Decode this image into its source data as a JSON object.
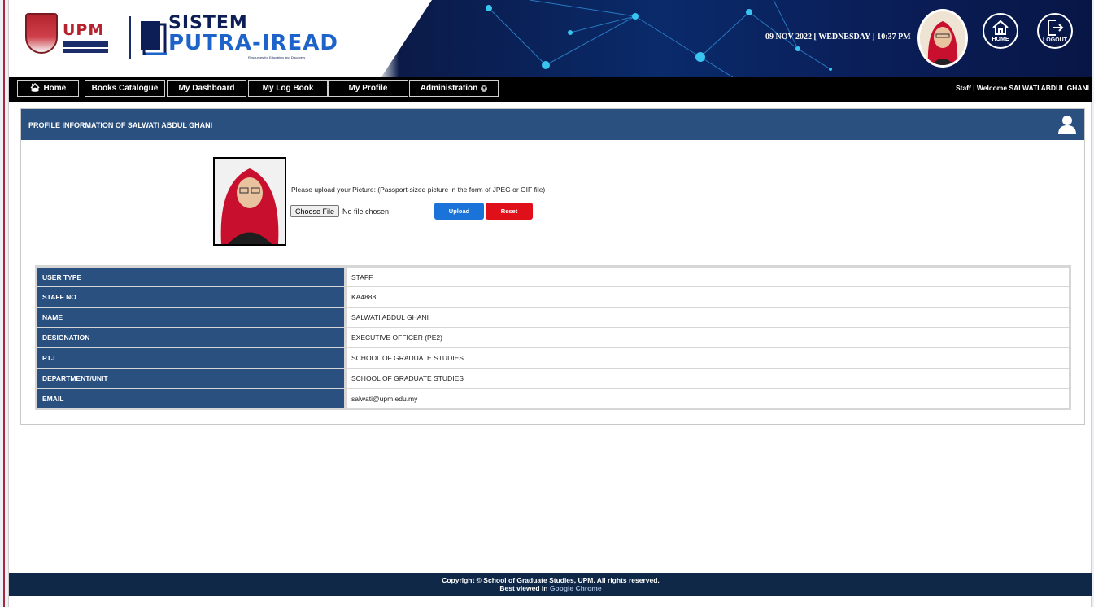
{
  "header": {
    "logo_text": "UPM",
    "brand_title_top": "SISTEM",
    "brand_title_main": "PUTRA-IREAD",
    "tagline": "Resources for Education and Discovery",
    "datetime": "09 NOV 2022 [ WEDNESDAY ] 10:37 PM",
    "home_label": "HOME",
    "logout_label": "LOGOUT",
    "home_icon": "home-icon",
    "logout_icon": "logout-icon"
  },
  "nav": {
    "items": [
      {
        "label": "Home",
        "icon": "home-icon"
      },
      {
        "label": "Books Catalogue"
      },
      {
        "label": "My Dashboard"
      },
      {
        "label": "My Log Book"
      },
      {
        "label": "My Profile"
      },
      {
        "label": "Administration",
        "icon": "chevron-down-icon"
      }
    ],
    "welcome": "Staff | Welcome SALWATI ABDUL GHANI"
  },
  "profile": {
    "title": "PROFILE INFORMATION OF SALWATI ABDUL GHANI",
    "upload_hint": "Please upload your Picture: (Passport-sized picture in the form of JPEG or GIF file)",
    "choose_file_label": "Choose File",
    "no_file_text": "No file chosen",
    "upload_label": "Upload",
    "reset_label": "Reset",
    "rows": [
      {
        "key": "USER TYPE",
        "value": "STAFF"
      },
      {
        "key": "STAFF NO",
        "value": "KA4888"
      },
      {
        "key": "NAME",
        "value": "SALWATI ABDUL GHANI"
      },
      {
        "key": "DESIGNATION",
        "value": "EXECUTIVE OFFICER (PE2)"
      },
      {
        "key": "PTJ",
        "value": "SCHOOL OF GRADUATE STUDIES"
      },
      {
        "key": "DEPARTMENT/UNIT",
        "value": "SCHOOL OF GRADUATE STUDIES"
      },
      {
        "key": "EMAIL",
        "value": "salwati@upm.edu.my"
      }
    ]
  },
  "footer": {
    "copyright": "Copyright © School of Graduate Studies, UPM. All rights reserved.",
    "best_viewed_prefix": "Best viewed in",
    "best_viewed_browser": "Google Chrome"
  },
  "colors": {
    "panel_header": "#2a5080",
    "navbar": "#000000",
    "footer": "#0f2847",
    "upload_button": "#1a73d8",
    "reset_button": "#e0101a",
    "accent_red": "#a8273f"
  }
}
